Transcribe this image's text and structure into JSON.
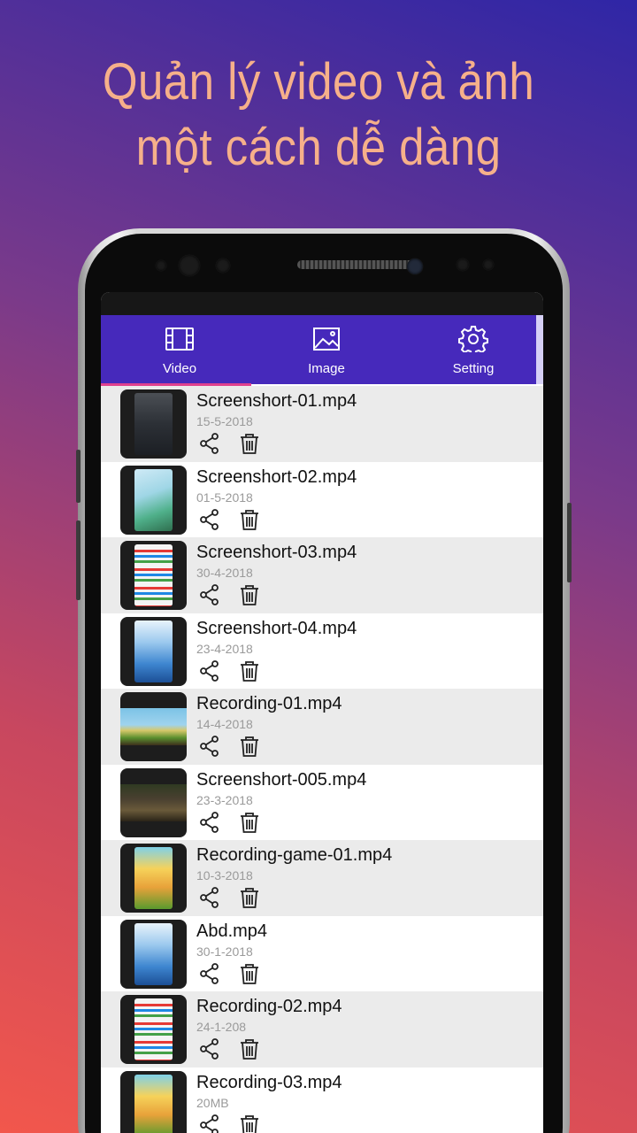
{
  "headline": {
    "line1": "Quản lý video và ảnh",
    "line2": "một cách dễ dàng"
  },
  "colors": {
    "headline": "#f6b08a",
    "tabbar": "#4629bb",
    "tab_indicator": "#e0418e",
    "row_shaded": "#ebebeb"
  },
  "tabs": [
    {
      "label": "Video",
      "icon": "film-icon",
      "active": true
    },
    {
      "label": "Image",
      "icon": "image-icon",
      "active": false
    },
    {
      "label": "Setting",
      "icon": "gear-icon",
      "active": false
    }
  ],
  "files": [
    {
      "name": "Screenshort-01.mp4",
      "meta": "15-5-2018",
      "thumb": "lockscreen"
    },
    {
      "name": "Screenshort-02.mp4",
      "meta": "01-5-2018",
      "thumb": "homescreen"
    },
    {
      "name": "Screenshort-03.mp4",
      "meta": "30-4-2018",
      "thumb": "appgrid"
    },
    {
      "name": "Screenshort-04.mp4",
      "meta": "23-4-2018",
      "thumb": "homeblue"
    },
    {
      "name": "Recording-01.mp4",
      "meta": "14-4-2018",
      "thumb": "game-wide"
    },
    {
      "name": "Screenshort-005.mp4",
      "meta": "23-3-2018",
      "thumb": "game-dark"
    },
    {
      "name": "Recording-game-01.mp4",
      "meta": "10-3-2018",
      "thumb": "puzzle"
    },
    {
      "name": "Abd.mp4",
      "meta": "30-1-2018",
      "thumb": "homeblue"
    },
    {
      "name": "Recording-02.mp4",
      "meta": "24-1-208",
      "thumb": "appgrid"
    },
    {
      "name": "Recording-03.mp4",
      "meta": "20MB",
      "thumb": "puzzle"
    }
  ],
  "actions": {
    "share_icon": "share-icon",
    "delete_icon": "trash-icon"
  }
}
